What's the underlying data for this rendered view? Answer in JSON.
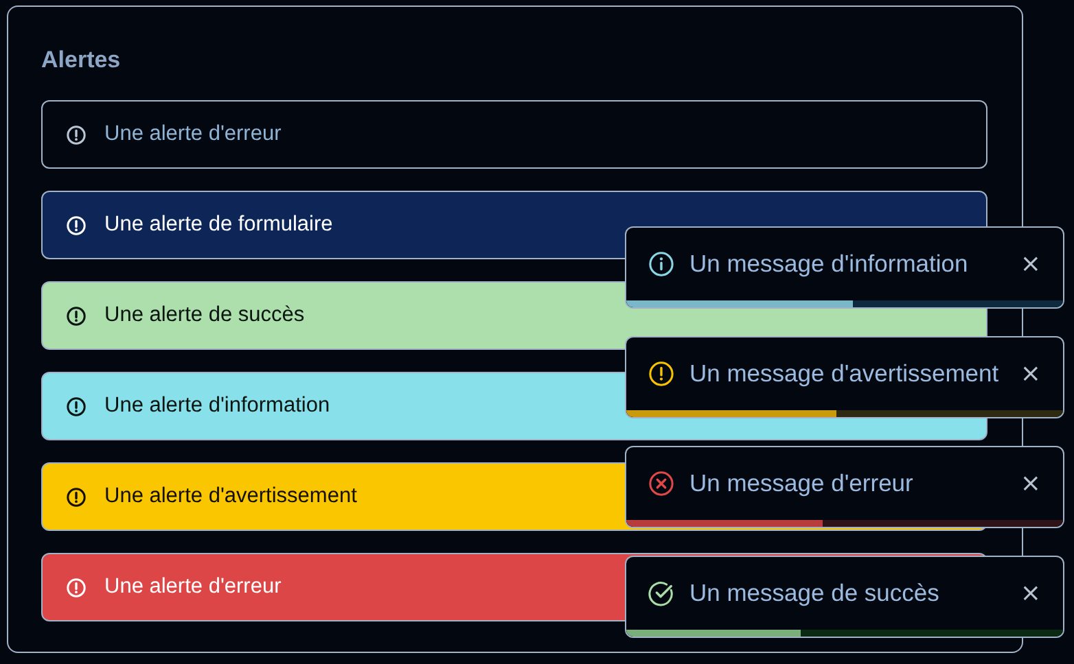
{
  "panel": {
    "title": "Alertes"
  },
  "alerts": [
    {
      "kind": "outline",
      "text": "Une alerte d'erreur"
    },
    {
      "kind": "form",
      "text": "Une alerte de formulaire"
    },
    {
      "kind": "success",
      "text": "Une alerte de succès"
    },
    {
      "kind": "info",
      "text": "Une alerte d'information"
    },
    {
      "kind": "warning",
      "text": "Une alerte d'avertissement"
    },
    {
      "kind": "error",
      "text": "Une alerte d'erreur"
    }
  ],
  "toasts": [
    {
      "kind": "info",
      "message": "Un message d'information",
      "close": "×",
      "level": 0.52
    },
    {
      "kind": "warning",
      "message": "Un message d'avertissement",
      "close": "×",
      "level": 0.48
    },
    {
      "kind": "error",
      "message": "Un message d'erreur",
      "close": "×",
      "level": 0.45
    },
    {
      "kind": "success",
      "message": "Un message de succès",
      "close": "×",
      "level": 0.4
    }
  ]
}
